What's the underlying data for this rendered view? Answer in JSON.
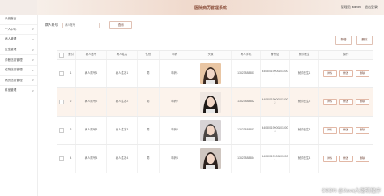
{
  "app": {
    "title": "医院病历管理系统"
  },
  "header": {
    "user_text": "管理员 admin",
    "exit_label": "退出登录"
  },
  "sidebar": {
    "items": [
      {
        "label": "系统首页",
        "has_chevron": false
      },
      {
        "label": "个人中心",
        "has_chevron": true
      },
      {
        "label": "病人管理",
        "has_chevron": true
      },
      {
        "label": "医生管理",
        "has_chevron": true
      },
      {
        "label": "诊断信息管理",
        "has_chevron": true
      },
      {
        "label": "住院信息管理",
        "has_chevron": true
      },
      {
        "label": "病历信息管理",
        "has_chevron": true
      },
      {
        "label": "科室管理",
        "has_chevron": true
      }
    ]
  },
  "search": {
    "label": "病人账号",
    "placeholder": "病人账号",
    "button": "查询"
  },
  "toolbar": {
    "add": "新增",
    "delete": "删除"
  },
  "table": {
    "headers": [
      "索引",
      "病人账号",
      "病人姓名",
      "性别",
      "年龄",
      "头像",
      "病人手机",
      "身份证",
      "就诊医生",
      "操作"
    ],
    "rows": [
      {
        "idx": "1",
        "account": "病人账号1",
        "name": "病人姓名1",
        "sex": "男",
        "age": "年龄1",
        "phone": "13823888881",
        "idcard": "440300199001010001",
        "doctor": "就诊医生1"
      },
      {
        "idx": "2",
        "account": "病人账号2",
        "name": "病人姓名2",
        "sex": "男",
        "age": "年龄2",
        "phone": "13823888882",
        "idcard": "440300199001010002",
        "doctor": "就诊医生2"
      },
      {
        "idx": "3",
        "account": "病人账号3",
        "name": "病人姓名3",
        "sex": "男",
        "age": "年龄3",
        "phone": "13823888883",
        "idcard": "440300199001010003",
        "doctor": "就诊医生3"
      },
      {
        "idx": "4",
        "account": "病人账号4",
        "name": "病人姓名4",
        "sex": "男",
        "age": "年龄4",
        "phone": "13823888884",
        "idcard": "440300199001010004",
        "doctor": "就诊医生4"
      }
    ],
    "ops": [
      "详情",
      "修改",
      "删除"
    ]
  },
  "watermark": "CSDN @Java大聪明程序",
  "colors": {
    "accent": "#8a4e3a",
    "button_border": "#e2b8a6",
    "row_highlight": "#fcf3ec"
  }
}
